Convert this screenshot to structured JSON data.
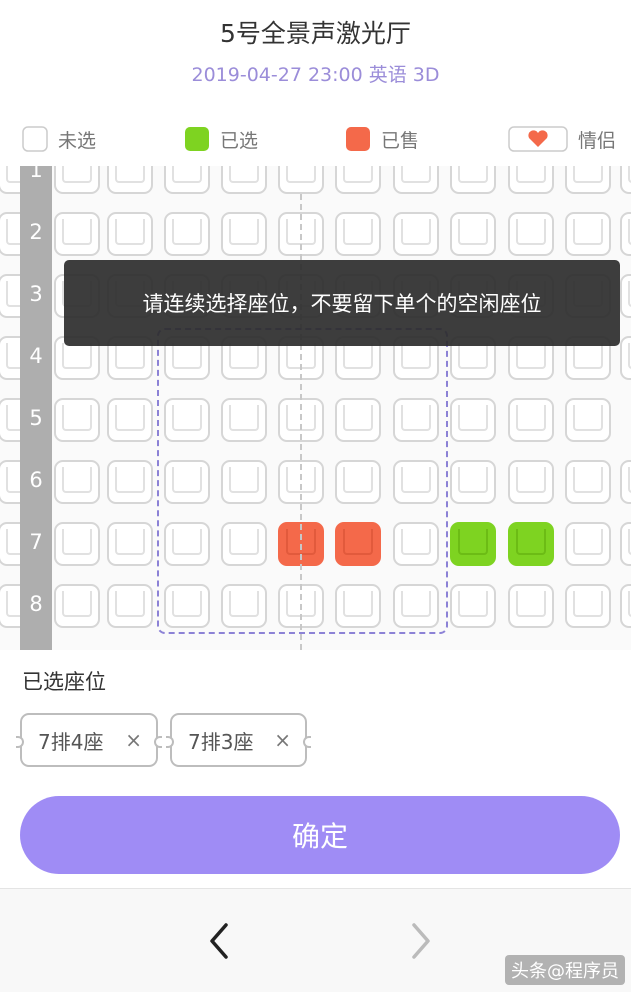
{
  "header": {
    "hall_name": "5号全景声激光厅",
    "showtime": "2019-04-27 23:00 英语 3D"
  },
  "legend": [
    {
      "label": "未选",
      "icon": "seat-available-icon"
    },
    {
      "label": "已选",
      "icon": "seat-selected-icon"
    },
    {
      "label": "已售",
      "icon": "seat-sold-icon"
    },
    {
      "label": "情侣",
      "icon": "couple-seat-icon"
    }
  ],
  "seat_map": {
    "rows": [
      "1",
      "2",
      "3",
      "4",
      "5",
      "6",
      "7",
      "8"
    ],
    "sold_seats": [
      {
        "row": "7",
        "seat_index": 5
      },
      {
        "row": "7",
        "seat_index": 6
      }
    ],
    "selected_seats": [
      {
        "row": "7",
        "seat_index": 8
      },
      {
        "row": "7",
        "seat_index": 9
      }
    ]
  },
  "toast": {
    "message": "请连续选择座位，不要留下单个的空闲座位"
  },
  "selected": {
    "title": "已选座位",
    "chips": [
      {
        "label": "7排4座",
        "remove": "×"
      },
      {
        "label": "7排3座",
        "remove": "×"
      }
    ]
  },
  "confirm": {
    "label": "确定"
  },
  "nav": {
    "back_icon": "chevron-left-icon",
    "forward_icon": "chevron-right-icon"
  },
  "watermark": "头条@程序员"
}
